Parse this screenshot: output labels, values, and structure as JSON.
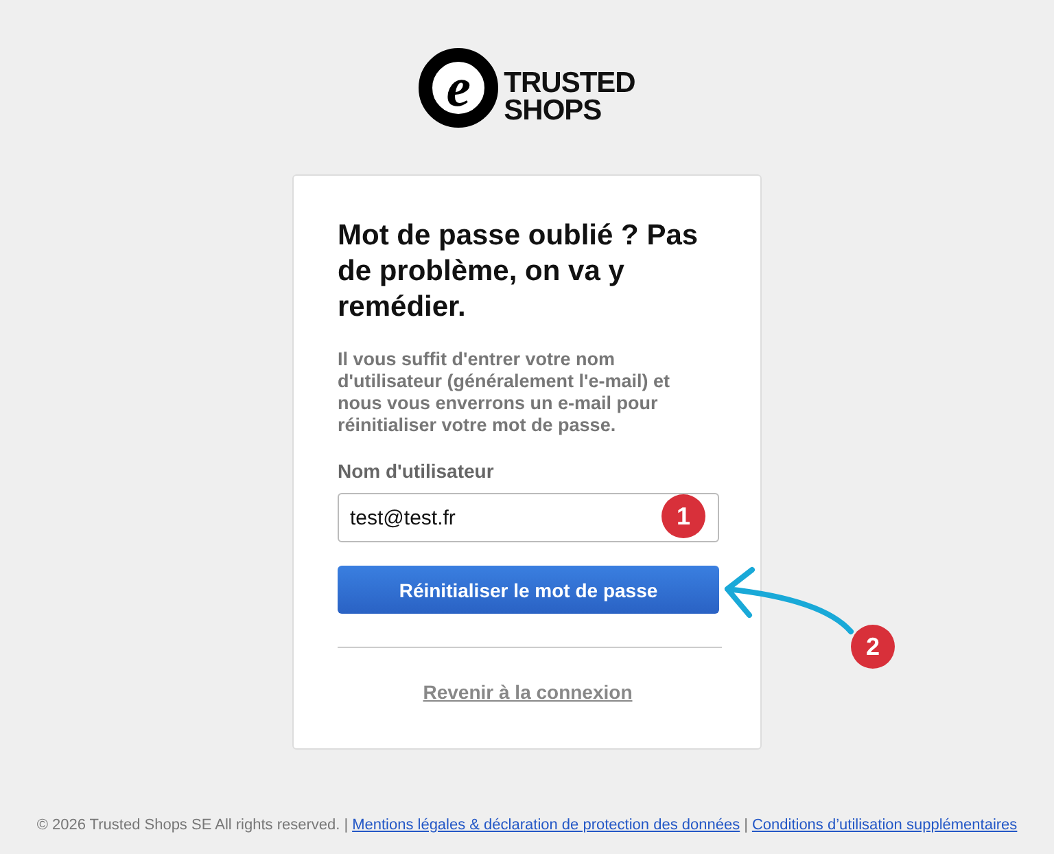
{
  "logo": {
    "mark": "e",
    "lines": [
      "TRUSTED",
      "SHOPS"
    ]
  },
  "card": {
    "title": "Mot de passe oublié ? Pas de problème, on va y remédier.",
    "description": "Il vous suffit d'entrer votre nom d'utilisateur (généralement l'e-mail) et nous vous enverrons un e-mail pour réinitialiser votre mot de passe.",
    "field": {
      "label": "Nom d'utilisateur",
      "value": "test@test.fr"
    },
    "button": "Réinitialiser le mot de passe",
    "back_link": "Revenir à la connexion"
  },
  "annotations": [
    {
      "number": "1",
      "kind": "badge"
    },
    {
      "number": "2",
      "kind": "arrow-badge"
    }
  ],
  "footer": {
    "copyright": "© 2026 Trusted Shops SE All rights reserved.",
    "separator": "|",
    "links": [
      "Mentions légales & déclaration de protection des données",
      "Conditions d’utilisation supplémentaires"
    ]
  }
}
